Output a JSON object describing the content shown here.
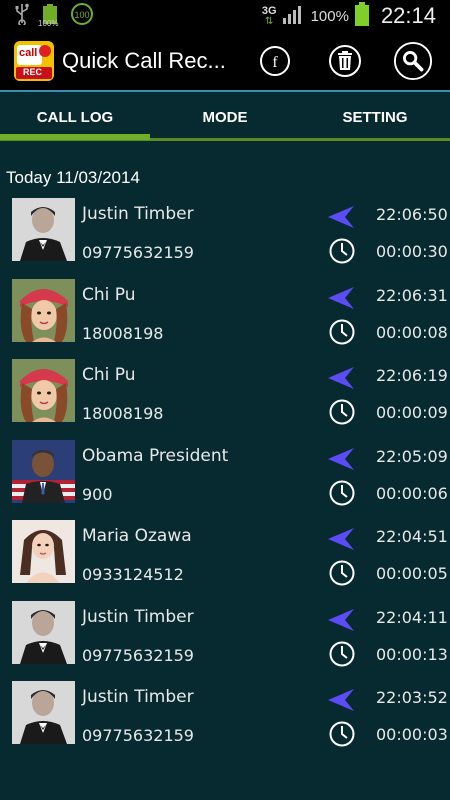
{
  "status_bar": {
    "network": "3G",
    "battery_percent": "100%",
    "time": "22:14",
    "left_battery_label": "100%"
  },
  "action_bar": {
    "icon_label": "REC",
    "icon_call_text": "call",
    "title": "Quick Call Rec..."
  },
  "tabs": [
    {
      "label": "CALL LOG",
      "active": true
    },
    {
      "label": "MODE",
      "active": false
    },
    {
      "label": "SETTING",
      "active": false
    }
  ],
  "section": {
    "header": "Today 11/03/2014"
  },
  "calls": [
    {
      "name": "Justin Timber",
      "number": "09775632159",
      "time": "22:06:50",
      "duration": "00:00:30",
      "avatar": "justin"
    },
    {
      "name": "Chi Pu",
      "number": "18008198",
      "time": "22:06:31",
      "duration": "00:00:08",
      "avatar": "chipu"
    },
    {
      "name": "Chi Pu",
      "number": "18008198",
      "time": "22:06:19",
      "duration": "00:00:09",
      "avatar": "chipu"
    },
    {
      "name": "Obama President",
      "number": "900",
      "time": "22:05:09",
      "duration": "00:00:06",
      "avatar": "obama"
    },
    {
      "name": "Maria Ozawa",
      "number": "0933124512",
      "time": "22:04:51",
      "duration": "00:00:05",
      "avatar": "maria"
    },
    {
      "name": "Justin Timber",
      "number": "09775632159",
      "time": "22:04:11",
      "duration": "00:00:13",
      "avatar": "justin"
    },
    {
      "name": "Justin Timber",
      "number": "09775632159",
      "time": "22:03:52",
      "duration": "00:00:03",
      "avatar": "justin"
    }
  ],
  "colors": {
    "background": "#072a31",
    "accent_blue": "#3a8fb0",
    "tab_green": "#6fae26",
    "outgoing_arrow": "#5b4cf5",
    "battery_green": "#7fcf2a"
  }
}
